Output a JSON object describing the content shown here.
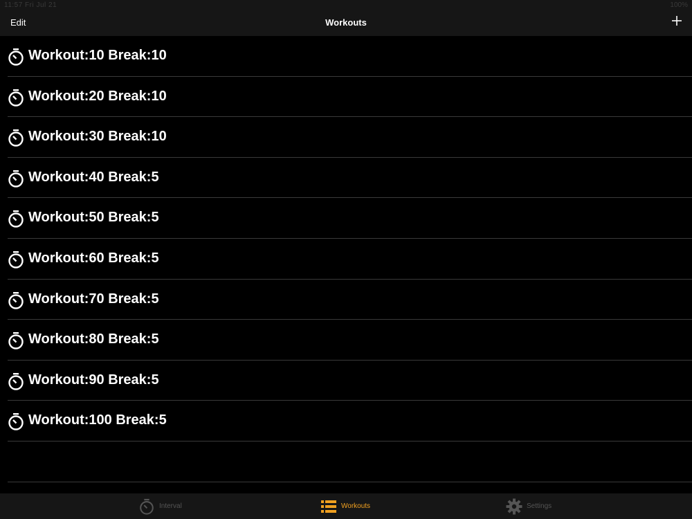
{
  "status": {
    "left": "11:57  Fri Jul 21",
    "right": "100%"
  },
  "nav": {
    "edit_label": "Edit",
    "title": "Workouts",
    "add_icon": "plus-icon"
  },
  "workouts": [
    {
      "label": "Workout:10 Break:10"
    },
    {
      "label": "Workout:20 Break:10"
    },
    {
      "label": "Workout:30 Break:10"
    },
    {
      "label": "Workout:40 Break:5"
    },
    {
      "label": "Workout:50 Break:5"
    },
    {
      "label": "Workout:60 Break:5"
    },
    {
      "label": "Workout:70 Break:5"
    },
    {
      "label": "Workout:80 Break:5"
    },
    {
      "label": "Workout:90 Break:5"
    },
    {
      "label": "Workout:100 Break:5"
    }
  ],
  "tabs": [
    {
      "label": "Interval",
      "icon": "stopwatch-icon",
      "active": false
    },
    {
      "label": "Workouts",
      "icon": "list-icon",
      "active": true
    },
    {
      "label": "Settings",
      "icon": "gear-icon",
      "active": false
    }
  ],
  "colors": {
    "active_tab": "#f0a020",
    "inactive_tab": "#555555",
    "background": "#000000",
    "bars": "#161616"
  }
}
